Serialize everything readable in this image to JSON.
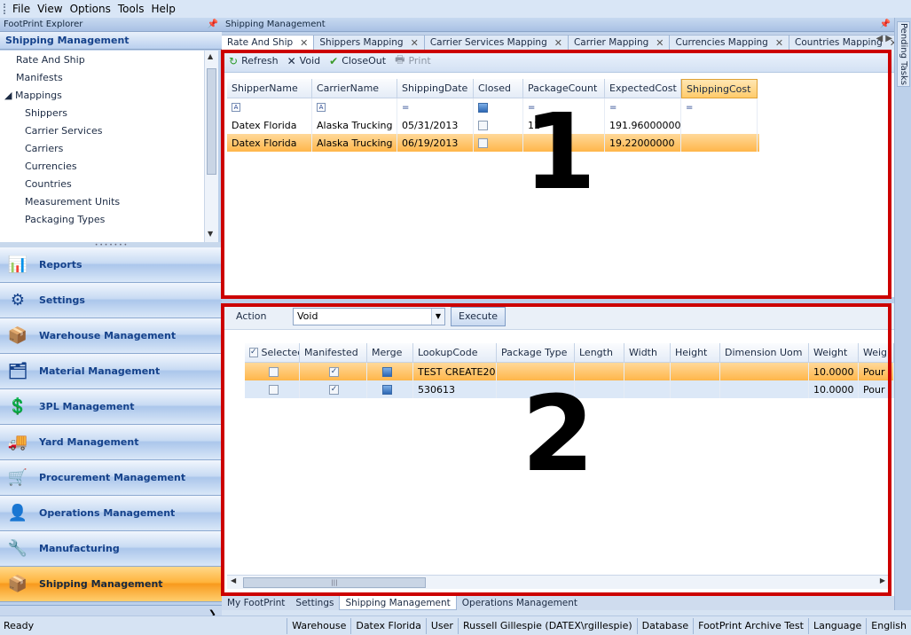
{
  "menu": [
    "File",
    "View",
    "Options",
    "Tools",
    "Help"
  ],
  "explorer": {
    "header": "FootPrint Explorer",
    "title": "Shipping Management",
    "tree": [
      {
        "label": "Rate And Ship",
        "level": "l1"
      },
      {
        "label": "Manifests",
        "level": "l1"
      },
      {
        "label": "◢ Mappings",
        "level": "lp"
      },
      {
        "label": "Shippers",
        "level": "l2"
      },
      {
        "label": "Carrier Services",
        "level": "l2"
      },
      {
        "label": "Carriers",
        "level": "l2"
      },
      {
        "label": "Currencies",
        "level": "l2"
      },
      {
        "label": "Countries",
        "level": "l2"
      },
      {
        "label": "Measurement Units",
        "level": "l2"
      },
      {
        "label": "Packaging Types",
        "level": "l2"
      }
    ],
    "modules": [
      {
        "label": "Reports",
        "icon": "reports-icon",
        "glyph": "📊"
      },
      {
        "label": "Settings",
        "icon": "settings-icon",
        "glyph": "⚙"
      },
      {
        "label": "Warehouse Management",
        "icon": "warehouse-icon",
        "glyph": "📦"
      },
      {
        "label": "Material Management",
        "icon": "material-icon",
        "glyph": "🗂"
      },
      {
        "label": "3PL Management",
        "icon": "3pl-icon",
        "glyph": "💲"
      },
      {
        "label": "Yard Management",
        "icon": "yard-icon",
        "glyph": "🚚"
      },
      {
        "label": "Procurement Management",
        "icon": "procurement-icon",
        "glyph": "🛒"
      },
      {
        "label": "Operations Management",
        "icon": "operations-icon",
        "glyph": "👤"
      },
      {
        "label": "Manufacturing",
        "icon": "manufacturing-icon",
        "glyph": "🔧"
      },
      {
        "label": "Shipping Management",
        "icon": "shipping-icon",
        "glyph": "📦",
        "selected": true
      }
    ]
  },
  "doc": {
    "header": "Shipping Management",
    "tabs": [
      "Rate And Ship",
      "Shippers Mapping",
      "Carrier Services Mapping",
      "Carrier Mapping",
      "Currencies Mapping",
      "Countries Mapping"
    ],
    "toolbar": {
      "refresh": "Refresh",
      "void": "Void",
      "closeout": "CloseOut",
      "print": "Print"
    },
    "grid1": {
      "columns": [
        "ShipperName",
        "CarrierName",
        "ShippingDate",
        "Closed",
        "PackageCount",
        "ExpectedCost",
        "ShippingCost"
      ],
      "rows": [
        [
          "Datex Florida",
          "Alaska Trucking",
          "05/31/2013",
          "",
          "11",
          "191.96000000",
          ""
        ],
        [
          "Datex Florida",
          "Alaska Trucking",
          "06/19/2013",
          "",
          "",
          "19.22000000",
          ""
        ]
      ]
    },
    "action": {
      "label": "Action",
      "value": "Void",
      "execute": "Execute"
    },
    "grid2": {
      "columns": [
        "Selected",
        "Manifested",
        "Merge",
        "LookupCode",
        "Package Type",
        "Length",
        "Width",
        "Height",
        "Dimension Uom",
        "Weight",
        "Weig"
      ],
      "rows": [
        [
          "",
          "✓",
          "",
          "TEST CREATE20...",
          "",
          "",
          "",
          "",
          "",
          "10.0000",
          "Pour"
        ],
        [
          "",
          "✓",
          "",
          "530613",
          "",
          "",
          "",
          "",
          "",
          "10.0000",
          "Pour"
        ]
      ]
    },
    "bottom_tabs": [
      "My FootPrint",
      "Settings",
      "Shipping Management",
      "Operations Management"
    ]
  },
  "annotations": [
    "1",
    "2"
  ],
  "right_panel": "Pending Tasks",
  "status": {
    "ready": "Ready",
    "items": [
      "Warehouse",
      "Datex Florida",
      "User",
      "Russell Gillespie (DATEX\\rgillespie)",
      "Database",
      "FootPrint Archive Test",
      "Language",
      "English"
    ]
  }
}
